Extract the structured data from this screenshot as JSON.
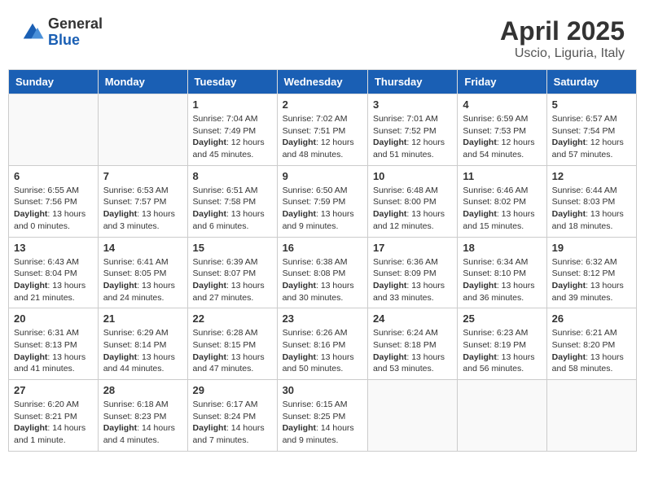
{
  "header": {
    "logo_general": "General",
    "logo_blue": "Blue",
    "month": "April 2025",
    "location": "Uscio, Liguria, Italy"
  },
  "days_of_week": [
    "Sunday",
    "Monday",
    "Tuesday",
    "Wednesday",
    "Thursday",
    "Friday",
    "Saturday"
  ],
  "weeks": [
    [
      {
        "day": "",
        "info": ""
      },
      {
        "day": "",
        "info": ""
      },
      {
        "day": "1",
        "info": "Sunrise: 7:04 AM\nSunset: 7:49 PM\nDaylight: 12 hours and 45 minutes."
      },
      {
        "day": "2",
        "info": "Sunrise: 7:02 AM\nSunset: 7:51 PM\nDaylight: 12 hours and 48 minutes."
      },
      {
        "day": "3",
        "info": "Sunrise: 7:01 AM\nSunset: 7:52 PM\nDaylight: 12 hours and 51 minutes."
      },
      {
        "day": "4",
        "info": "Sunrise: 6:59 AM\nSunset: 7:53 PM\nDaylight: 12 hours and 54 minutes."
      },
      {
        "day": "5",
        "info": "Sunrise: 6:57 AM\nSunset: 7:54 PM\nDaylight: 12 hours and 57 minutes."
      }
    ],
    [
      {
        "day": "6",
        "info": "Sunrise: 6:55 AM\nSunset: 7:56 PM\nDaylight: 13 hours and 0 minutes."
      },
      {
        "day": "7",
        "info": "Sunrise: 6:53 AM\nSunset: 7:57 PM\nDaylight: 13 hours and 3 minutes."
      },
      {
        "day": "8",
        "info": "Sunrise: 6:51 AM\nSunset: 7:58 PM\nDaylight: 13 hours and 6 minutes."
      },
      {
        "day": "9",
        "info": "Sunrise: 6:50 AM\nSunset: 7:59 PM\nDaylight: 13 hours and 9 minutes."
      },
      {
        "day": "10",
        "info": "Sunrise: 6:48 AM\nSunset: 8:00 PM\nDaylight: 13 hours and 12 minutes."
      },
      {
        "day": "11",
        "info": "Sunrise: 6:46 AM\nSunset: 8:02 PM\nDaylight: 13 hours and 15 minutes."
      },
      {
        "day": "12",
        "info": "Sunrise: 6:44 AM\nSunset: 8:03 PM\nDaylight: 13 hours and 18 minutes."
      }
    ],
    [
      {
        "day": "13",
        "info": "Sunrise: 6:43 AM\nSunset: 8:04 PM\nDaylight: 13 hours and 21 minutes."
      },
      {
        "day": "14",
        "info": "Sunrise: 6:41 AM\nSunset: 8:05 PM\nDaylight: 13 hours and 24 minutes."
      },
      {
        "day": "15",
        "info": "Sunrise: 6:39 AM\nSunset: 8:07 PM\nDaylight: 13 hours and 27 minutes."
      },
      {
        "day": "16",
        "info": "Sunrise: 6:38 AM\nSunset: 8:08 PM\nDaylight: 13 hours and 30 minutes."
      },
      {
        "day": "17",
        "info": "Sunrise: 6:36 AM\nSunset: 8:09 PM\nDaylight: 13 hours and 33 minutes."
      },
      {
        "day": "18",
        "info": "Sunrise: 6:34 AM\nSunset: 8:10 PM\nDaylight: 13 hours and 36 minutes."
      },
      {
        "day": "19",
        "info": "Sunrise: 6:32 AM\nSunset: 8:12 PM\nDaylight: 13 hours and 39 minutes."
      }
    ],
    [
      {
        "day": "20",
        "info": "Sunrise: 6:31 AM\nSunset: 8:13 PM\nDaylight: 13 hours and 41 minutes."
      },
      {
        "day": "21",
        "info": "Sunrise: 6:29 AM\nSunset: 8:14 PM\nDaylight: 13 hours and 44 minutes."
      },
      {
        "day": "22",
        "info": "Sunrise: 6:28 AM\nSunset: 8:15 PM\nDaylight: 13 hours and 47 minutes."
      },
      {
        "day": "23",
        "info": "Sunrise: 6:26 AM\nSunset: 8:16 PM\nDaylight: 13 hours and 50 minutes."
      },
      {
        "day": "24",
        "info": "Sunrise: 6:24 AM\nSunset: 8:18 PM\nDaylight: 13 hours and 53 minutes."
      },
      {
        "day": "25",
        "info": "Sunrise: 6:23 AM\nSunset: 8:19 PM\nDaylight: 13 hours and 56 minutes."
      },
      {
        "day": "26",
        "info": "Sunrise: 6:21 AM\nSunset: 8:20 PM\nDaylight: 13 hours and 58 minutes."
      }
    ],
    [
      {
        "day": "27",
        "info": "Sunrise: 6:20 AM\nSunset: 8:21 PM\nDaylight: 14 hours and 1 minute."
      },
      {
        "day": "28",
        "info": "Sunrise: 6:18 AM\nSunset: 8:23 PM\nDaylight: 14 hours and 4 minutes."
      },
      {
        "day": "29",
        "info": "Sunrise: 6:17 AM\nSunset: 8:24 PM\nDaylight: 14 hours and 7 minutes."
      },
      {
        "day": "30",
        "info": "Sunrise: 6:15 AM\nSunset: 8:25 PM\nDaylight: 14 hours and 9 minutes."
      },
      {
        "day": "",
        "info": ""
      },
      {
        "day": "",
        "info": ""
      },
      {
        "day": "",
        "info": ""
      }
    ]
  ]
}
